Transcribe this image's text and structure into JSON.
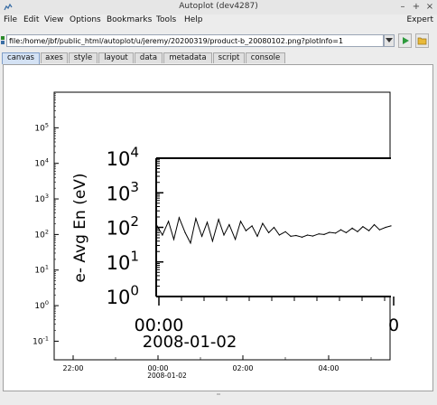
{
  "window": {
    "title": "Autoplot (dev4287)",
    "controls": [
      "–",
      "+",
      "×"
    ]
  },
  "menubar": {
    "items": [
      "File",
      "Edit",
      "View",
      "Options",
      "Bookmarks",
      "Tools",
      "Help"
    ],
    "right_label": "Expert"
  },
  "urlbar": {
    "value": "file:/home/jbf/public_html/autoplot/u/jeremy/20200319/product-b_20080102.png?plotInfo=1"
  },
  "tabs": [
    {
      "label": "canvas",
      "active": true
    },
    {
      "label": "axes",
      "active": false
    },
    {
      "label": "style",
      "active": false
    },
    {
      "label": "layout",
      "active": false
    },
    {
      "label": "data",
      "active": false
    },
    {
      "label": "metadata",
      "active": false
    },
    {
      "label": "script",
      "active": false
    },
    {
      "label": "console",
      "active": false
    }
  ],
  "outer_plot": {
    "y_axis": {
      "scale": "log",
      "range": [
        0.03,
        1000000
      ],
      "ticks": [
        {
          "base": "10",
          "exp": "5",
          "value": 100000
        },
        {
          "base": "10",
          "exp": "4",
          "value": 10000
        },
        {
          "base": "10",
          "exp": "3",
          "value": 1000
        },
        {
          "base": "10",
          "exp": "2",
          "value": 100
        },
        {
          "base": "10",
          "exp": "1",
          "value": 10
        },
        {
          "base": "10",
          "exp": "0",
          "value": 1
        },
        {
          "base": "10",
          "exp": "-1",
          "value": 0.1
        }
      ]
    },
    "x_axis": {
      "ticks": [
        {
          "label": "22:00",
          "sub": ""
        },
        {
          "label": "00:00",
          "sub": "2008-01-02"
        },
        {
          "label": "02:00",
          "sub": ""
        },
        {
          "label": "04:00",
          "sub": ""
        }
      ]
    }
  },
  "chart_data": {
    "type": "line",
    "title": "",
    "xlabel": "",
    "ylabel": "e- Avg En (eV)",
    "y_scale": "log",
    "ylim": [
      1,
      10000
    ],
    "y_ticks": [
      {
        "base": "10",
        "exp": "4"
      },
      {
        "base": "10",
        "exp": "3"
      },
      {
        "base": "10",
        "exp": "2"
      },
      {
        "base": "10",
        "exp": "1"
      },
      {
        "base": "10",
        "exp": "0"
      }
    ],
    "x_ticks": [
      {
        "label": "00:00",
        "sub": "2008-01-02"
      },
      {
        "label": "0",
        "sub": ""
      }
    ],
    "series": [
      {
        "x_hours": [
          0.0,
          0.08,
          0.17,
          0.25,
          0.33,
          0.42,
          0.5,
          0.58,
          0.67,
          0.75,
          0.83,
          0.92,
          1.0,
          1.08,
          1.17,
          1.25,
          1.33,
          1.42,
          1.5,
          1.58,
          1.67,
          1.75,
          1.83,
          1.92,
          2.0,
          2.08,
          2.17,
          2.25,
          2.33,
          2.42,
          2.5,
          2.58,
          2.67,
          2.75,
          2.83,
          2.92,
          3.0,
          3.08,
          3.17,
          3.25,
          3.33,
          3.42,
          3.5
        ],
        "values": [
          110,
          60,
          150,
          45,
          190,
          70,
          35,
          180,
          55,
          140,
          40,
          170,
          60,
          120,
          45,
          150,
          80,
          110,
          55,
          130,
          70,
          100,
          60,
          75,
          55,
          58,
          52,
          60,
          56,
          65,
          62,
          72,
          68,
          85,
          70,
          95,
          75,
          105,
          80,
          120,
          85,
          100,
          110
        ]
      }
    ]
  }
}
